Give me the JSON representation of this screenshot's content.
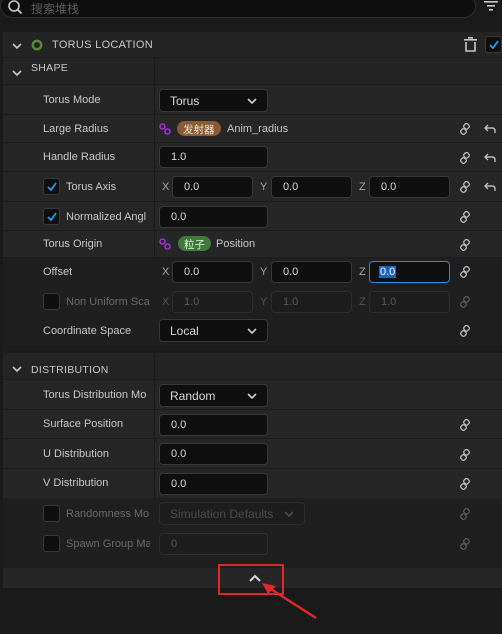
{
  "search": {
    "placeholder": "搜索堆栈"
  },
  "module": {
    "title": "TORUS LOCATION",
    "status_color": "#5b8a3a",
    "enabled": true
  },
  "sections": {
    "shape": {
      "title": "SHAPE",
      "rows": {
        "torus_mode": {
          "label": "Torus Mode",
          "value": "Torus"
        },
        "large_radius": {
          "label": "Large Radius",
          "badge": "发射器",
          "badge_color": "#8b5a33",
          "value": "Anim_radius"
        },
        "handle_radius": {
          "label": "Handle Radius",
          "value": "1.0"
        },
        "torus_axis": {
          "label": "Torus Axis",
          "checked": true,
          "x": "0.0",
          "y": "0.0",
          "z": "0.0"
        },
        "normalized_angle": {
          "label": "Normalized Angl",
          "checked": true,
          "value": "0.0"
        },
        "torus_origin": {
          "label": "Torus Origin",
          "badge": "粒子",
          "badge_color": "#3f7a3a",
          "value": "Position"
        },
        "offset": {
          "label": "Offset",
          "x": "0.0",
          "y": "0.0",
          "z": "0.0"
        },
        "non_uniform_scale": {
          "label": "Non Uniform Sca",
          "checked": false,
          "x": "1.0",
          "y": "1.0",
          "z": "1.0"
        },
        "coordinate_space": {
          "label": "Coordinate Space",
          "value": "Local"
        }
      }
    },
    "distribution": {
      "title": "DISTRIBUTION",
      "rows": {
        "torus_distribution_mode": {
          "label": "Torus Distribution Mo",
          "value": "Random"
        },
        "surface_position": {
          "label": "Surface Position",
          "value": "0.0"
        },
        "u_distribution": {
          "label": "U Distribution",
          "value": "0.0"
        },
        "v_distribution": {
          "label": "V Distribution",
          "value": "0.0"
        },
        "randomness_mode": {
          "label": "Randomness Mo",
          "checked": false,
          "value": "Simulation Defaults"
        },
        "spawn_group_mask": {
          "label": "Spawn Group Ma",
          "checked": false,
          "value": "0"
        }
      }
    }
  },
  "axes": {
    "x": "X",
    "y": "Y",
    "z": "Z"
  },
  "icons": {
    "search": "search-icon",
    "filter": "filter-icon",
    "delete": "trash-icon",
    "link": "link-icon",
    "reset": "reset-arrow-icon",
    "collapse": "chevron-up-icon"
  },
  "annotation": {
    "color": "#e0282a"
  }
}
